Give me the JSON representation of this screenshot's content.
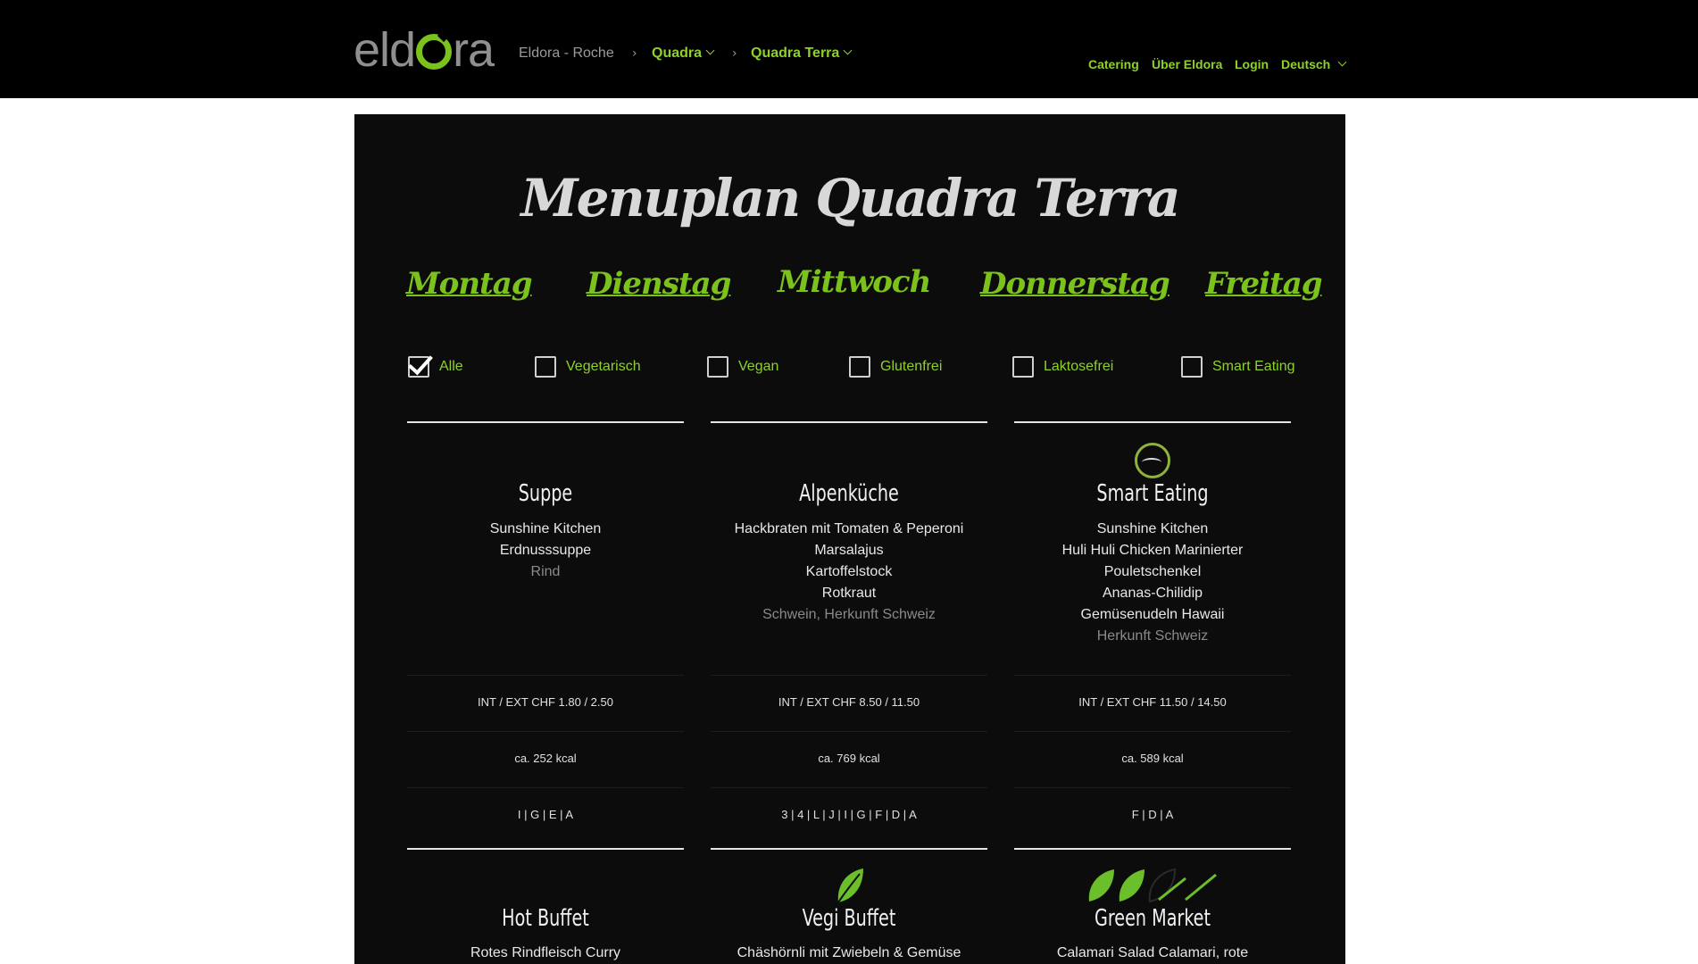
{
  "header": {
    "logo_text": "eld",
    "logo_text_end": "ra",
    "breadcrumb": [
      {
        "label": "Eldora - Roche"
      },
      {
        "label": "Quadra"
      },
      {
        "label": "Quadra Terra"
      }
    ],
    "right_nav": [
      {
        "label": "Catering"
      },
      {
        "label": "Über Eldora"
      },
      {
        "label": "Login"
      },
      {
        "label": "Deutsch"
      }
    ]
  },
  "menu": {
    "title": "Menuplan Quadra Terra",
    "days": [
      "Montag",
      "Dienstag",
      "Mittwoch",
      "Donnerstag",
      "Freitag"
    ],
    "active_day": "Mittwoch",
    "filters": [
      {
        "label": "Alle",
        "checked": true
      },
      {
        "label": "Vegetarisch",
        "checked": false
      },
      {
        "label": "Vegan",
        "checked": false
      },
      {
        "label": "Glutenfrei",
        "checked": false
      },
      {
        "label": "Laktosefrei",
        "checked": false
      },
      {
        "label": "Smart Eating",
        "checked": false
      }
    ],
    "items": [
      {
        "category": "Suppe",
        "lines": [
          "Sunshine Kitchen",
          "Erdnusssuppe"
        ],
        "origin": "Rind",
        "price": "INT / EXT CHF 1.80 / 2.50",
        "kcal": "ca. 252 kcal",
        "allergens": "I | G | E | A"
      },
      {
        "category": "Alpenküche",
        "lines": [
          "Hackbraten mit Tomaten & Peperoni",
          "Marsalajus",
          "Kartoffelstock",
          "Rotkraut"
        ],
        "origin": "Schwein, Herkunft Schweiz",
        "price": "INT / EXT CHF 8.50 / 11.50",
        "kcal": "ca. 769 kcal",
        "allergens": "3 | 4 | L | J | I | G | F | D | A"
      },
      {
        "category": "Smart Eating",
        "lines": [
          "Sunshine Kitchen",
          "Huli Huli Chicken Marinierter",
          "Pouletschenkel",
          "Ananas-Chilidip",
          "Gemüsenudeln Hawaii"
        ],
        "origin": "Herkunft Schweiz",
        "price": "INT / EXT CHF 11.50 / 14.50",
        "kcal": "ca. 589 kcal",
        "allergens": "F | D | A"
      },
      {
        "category": "Hot Buffet",
        "lines": [
          "Rotes Rindfleisch Curry"
        ]
      },
      {
        "category": "Vegi Buffet",
        "lines": [
          "Chäshörnli mit Zwiebeln & Gemüse"
        ]
      },
      {
        "category": "Green Market",
        "lines": [
          "Calamari Salad Calamari, rote"
        ]
      }
    ]
  },
  "colors": {
    "accent_green": "#7cc21c",
    "nav_green": "#8fd12b",
    "panel_bg": "#0c0c0c",
    "topbar_bg": "#000000"
  },
  "icons": [
    "chevron-down-icon",
    "chevron-right-icon",
    "checkbox-icon",
    "smart-eating-icon",
    "leaf-icon"
  ]
}
